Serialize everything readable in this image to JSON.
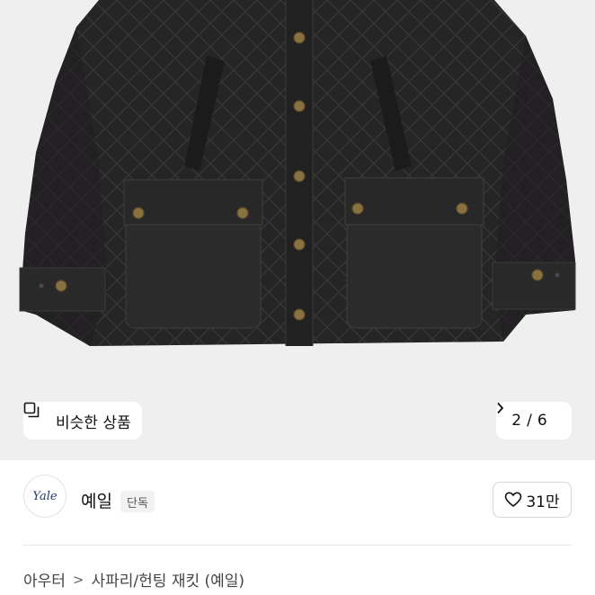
{
  "similar": {
    "label": "비슷한 상품",
    "icon": "similar-items-icon"
  },
  "pager": {
    "current": "2",
    "sep": "/",
    "total": "6",
    "icon": "chevron-right-icon"
  },
  "brand": {
    "logo_text": "Yale",
    "name": "예일",
    "tag": "단독"
  },
  "like": {
    "icon": "heart-icon",
    "count": "31만"
  },
  "breadcrumb": {
    "items": [
      "아우터",
      "사파리/헌팅 재킷 (예일)"
    ],
    "separator": ">"
  },
  "colors": {
    "background": "#efefef",
    "jacket": "#262526",
    "button": "#8a7240",
    "accent": "#111111"
  }
}
